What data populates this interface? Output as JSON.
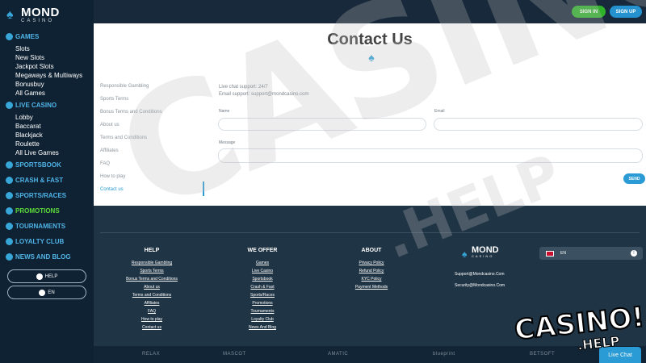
{
  "brand": {
    "name": "MOND",
    "sub": "CASINO"
  },
  "header": {
    "signin": "SIGN IN",
    "signup": "SIGN UP"
  },
  "sidebar": {
    "sections": [
      {
        "label": "GAMES",
        "items": [
          "Slots",
          "New Slots",
          "Jackpot Slots",
          "Megaways & Multiways",
          "Bonusbuy",
          "All Games"
        ]
      },
      {
        "label": "LIVE CASINO",
        "items": [
          "Lobby",
          "Baccarat",
          "Blackjack",
          "Roulette",
          "All Live Games"
        ]
      },
      {
        "label": "SPORTSBOOK",
        "items": []
      },
      {
        "label": "CRASH & FAST",
        "items": []
      },
      {
        "label": "SPORTS/RACES",
        "items": []
      },
      {
        "label": "PROMOTIONS",
        "items": [],
        "accent": "#5ddc3a"
      },
      {
        "label": "TOURNAMENTS",
        "items": []
      },
      {
        "label": "LOYALTY CLUB",
        "items": []
      },
      {
        "label": "NEWS AND BLOG",
        "items": []
      }
    ],
    "help_button": "HELP",
    "lang_button": "EN"
  },
  "contact": {
    "title": "Contact Us",
    "menu": [
      "Responsible Gambling",
      "Sports Terms",
      "Bonus Terms and Conditions",
      "About us",
      "Terms and Conditions",
      "Affiliates",
      "FAQ",
      "How to play",
      "Contact us"
    ],
    "active_menu": "Contact us",
    "info_line1": "Live chat support: 24/7",
    "info_line2": "Email support: support@mondcasino.com",
    "name_label": "Name",
    "email_label": "Email",
    "message_label": "Message",
    "send": "SEND"
  },
  "footer": {
    "help": {
      "title": "HELP",
      "links": [
        "Responsible Gambling",
        "Sports Terms",
        "Bonus Terms and Conditions",
        "About us",
        "Terms and Conditions",
        "Affiliates",
        "FAQ",
        "How to play",
        "Contact us"
      ]
    },
    "offer": {
      "title": "WE OFFER",
      "links": [
        "Games",
        "Live Casino",
        "Sportsbook",
        "Crash & Fast",
        "Sports/Races",
        "Promotions",
        "Tournaments",
        "Loyalty Club",
        "News And Blog"
      ]
    },
    "about": {
      "title": "ABOUT",
      "links": [
        "Privacy Policy",
        "Refund Policy",
        "KYC Policy",
        "Payment Methods"
      ]
    },
    "support_email": "Support@Mondcasino.Com",
    "security_email": "Security@Mondcasino.Com",
    "language": "EN"
  },
  "providers": [
    "RELAX",
    "MASCOT",
    "AMATIC",
    "blueprint",
    "BETSOFT"
  ],
  "live_chat": "Live Chat",
  "watermark": {
    "big": "CASINO",
    "help": ".HELP",
    "stamp_main": "CASINO!",
    "stamp_sub": ".HELP"
  },
  "colors": {
    "accent": "#2a9bd4",
    "green": "#2fb12a",
    "sidebar_bg": "#0f2233",
    "footer_bg": "#1f3445"
  }
}
